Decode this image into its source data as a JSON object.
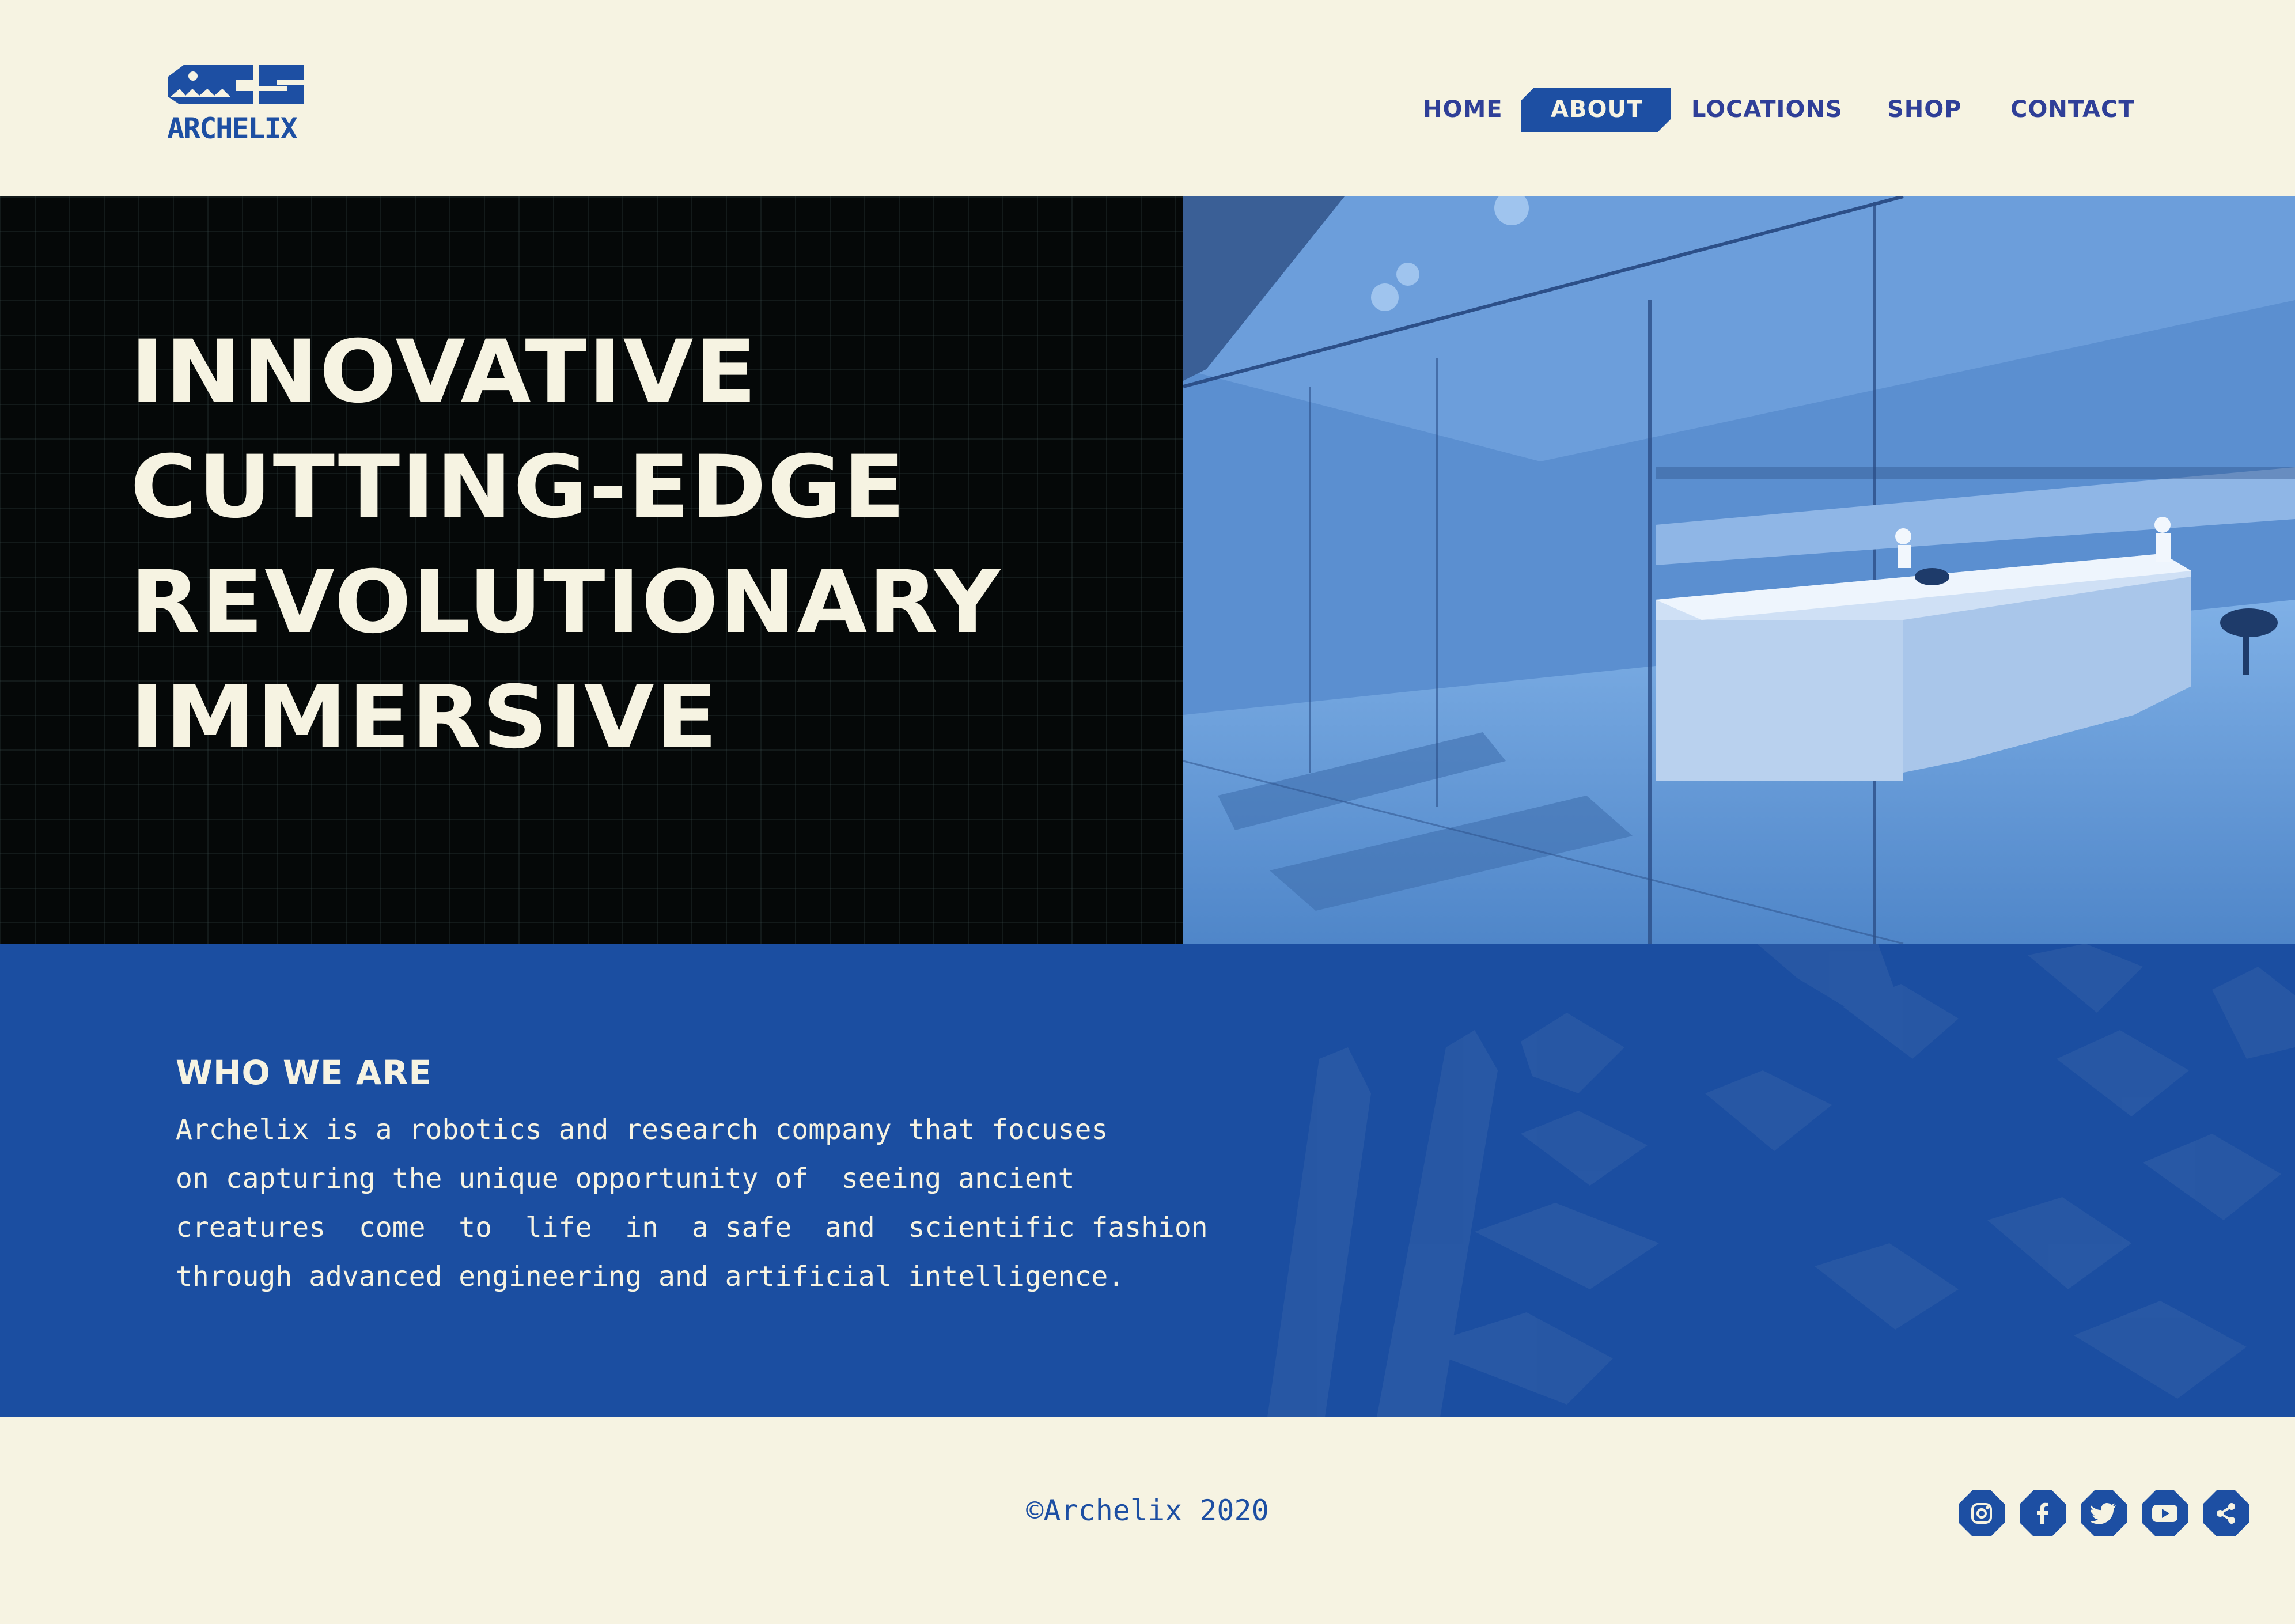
{
  "brand": {
    "logo_text": "ARCHELIX",
    "primary": "#1d4fa3",
    "cream": "#f6f3e2",
    "dark": "#050808"
  },
  "nav": {
    "items": [
      {
        "label": "HOME",
        "active": false
      },
      {
        "label": "ABOUT",
        "active": true
      },
      {
        "label": "LOCATIONS",
        "active": false
      },
      {
        "label": "SHOP",
        "active": false
      },
      {
        "label": "CONTACT",
        "active": false
      }
    ]
  },
  "hero": {
    "lines": [
      "INNOVATIVE",
      "CUTTING-EDGE",
      "REVOLUTIONARY",
      "IMMERSIVE"
    ],
    "image": "laboratory-photo"
  },
  "about": {
    "title": "WHO WE ARE",
    "lines": [
      "Archelix is a robotics and research company that focuses",
      "on capturing the unique opportunity of  seeing ancient",
      "creatures  come  to  life  in  a safe  and  scientific fashion",
      "through advanced engineering and artificial intelligence."
    ]
  },
  "footer": {
    "copyright": "©Archelix 2020",
    "social": [
      "instagram-icon",
      "facebook-icon",
      "twitter-icon",
      "youtube-icon",
      "share-icon"
    ]
  }
}
